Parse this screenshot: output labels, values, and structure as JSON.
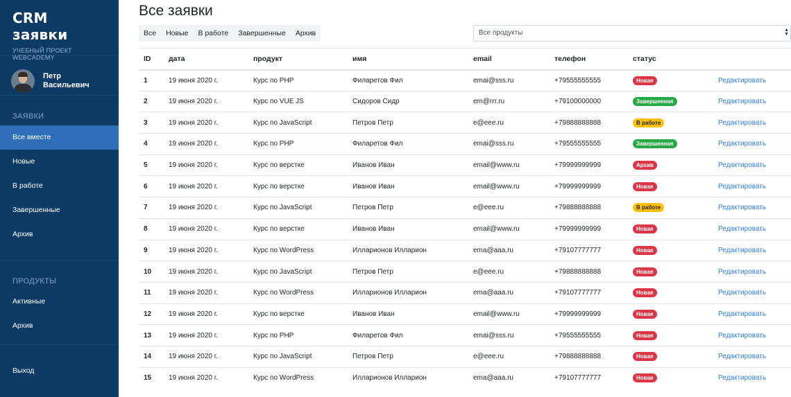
{
  "sidebar": {
    "brand_title": "CRM заявки",
    "brand_subtitle": "УЧЕБНЫЙ ПРОЕКТ WEBCADEMY",
    "user_first": "Петр",
    "user_last": "Васильевич",
    "section_requests": "ЗАЯВКИ",
    "requests_items": [
      "Все вместе",
      "Новые",
      "В работе",
      "Завершенные",
      "Архив"
    ],
    "section_products": "ПРОДУКТЫ",
    "products_items": [
      "Активные",
      "Архив"
    ],
    "logout": "Выход"
  },
  "main": {
    "title": "Все заявки",
    "filters": [
      "Все",
      "Новые",
      "В работе",
      "Завершенные",
      "Архив"
    ],
    "product_select": "Все продукты"
  },
  "table": {
    "headers": [
      "ID",
      "дата",
      "продукт",
      "имя",
      "email",
      "телефон",
      "статус",
      ""
    ],
    "edit_label": "Редактировать",
    "rows": [
      {
        "id": "1",
        "date": "19 июня 2020 г.",
        "product": "Курс по PHP",
        "name": "Филаретов Фил",
        "email": "emai@sss.ru",
        "phone": "+79555555555",
        "status": "Новая",
        "status_type": "new"
      },
      {
        "id": "2",
        "date": "19 июня 2020 г.",
        "product": "Курс по VUE JS",
        "name": "Сидоров Сидр",
        "email": "em@rrr.ru",
        "phone": "+79100000000",
        "status": "Завершенная",
        "status_type": "done"
      },
      {
        "id": "3",
        "date": "19 июня 2020 г.",
        "product": "Курс по JavaScript",
        "name": "Петров Петр",
        "email": "e@eee.ru",
        "phone": "+79888888888",
        "status": "В работе",
        "status_type": "work"
      },
      {
        "id": "4",
        "date": "19 июня 2020 г.",
        "product": "Курс по PHP",
        "name": "Филаретов Фил",
        "email": "emai@sss.ru",
        "phone": "+79555555555",
        "status": "Завершенная",
        "status_type": "done"
      },
      {
        "id": "5",
        "date": "19 июня 2020 г.",
        "product": "Курс по верстке",
        "name": "Иванов Иван",
        "email": "email@www.ru",
        "phone": "+79999999999",
        "status": "Архив",
        "status_type": "archive"
      },
      {
        "id": "6",
        "date": "19 июня 2020 г.",
        "product": "Курс по верстке",
        "name": "Иванов Иван",
        "email": "email@www.ru",
        "phone": "+79999999999",
        "status": "Новая",
        "status_type": "new"
      },
      {
        "id": "7",
        "date": "19 июня 2020 г.",
        "product": "Курс по JavaScript",
        "name": "Петров Петр",
        "email": "e@eee.ru",
        "phone": "+79888888888",
        "status": "В работе",
        "status_type": "work"
      },
      {
        "id": "8",
        "date": "19 июня 2020 г.",
        "product": "Курс по верстке",
        "name": "Иванов Иван",
        "email": "email@www.ru",
        "phone": "+79999999999",
        "status": "Новая",
        "status_type": "new"
      },
      {
        "id": "9",
        "date": "19 июня 2020 г.",
        "product": "Курс по WordPress",
        "name": "Илларионов Илларион",
        "email": "ema@aaa.ru",
        "phone": "+79107777777",
        "status": "Новая",
        "status_type": "new"
      },
      {
        "id": "10",
        "date": "19 июня 2020 г.",
        "product": "Курс по JavaScript",
        "name": "Петров Петр",
        "email": "e@eee.ru",
        "phone": "+79888888888",
        "status": "Новая",
        "status_type": "new"
      },
      {
        "id": "11",
        "date": "19 июня 2020 г.",
        "product": "Курс по WordPress",
        "name": "Илларионов Илларион",
        "email": "ema@aaa.ru",
        "phone": "+79107777777",
        "status": "Новая",
        "status_type": "new"
      },
      {
        "id": "12",
        "date": "19 июня 2020 г.",
        "product": "Курс по верстке",
        "name": "Иванов Иван",
        "email": "email@www.ru",
        "phone": "+79999999999",
        "status": "Новая",
        "status_type": "new"
      },
      {
        "id": "13",
        "date": "19 июня 2020 г.",
        "product": "Курс по PHP",
        "name": "Филаретов Фил",
        "email": "emai@sss.ru",
        "phone": "+79555555555",
        "status": "Новая",
        "status_type": "new"
      },
      {
        "id": "14",
        "date": "19 июня 2020 г.",
        "product": "Курс по JavaScript",
        "name": "Петров Петр",
        "email": "e@eee.ru",
        "phone": "+79888888888",
        "status": "Новая",
        "status_type": "new"
      },
      {
        "id": "15",
        "date": "19 июня 2020 г.",
        "product": "Курс по WordPress",
        "name": "Илларионов Илларион",
        "email": "ema@aaa.ru",
        "phone": "+79107777777",
        "status": "Новая",
        "status_type": "new"
      }
    ]
  },
  "colors": {
    "sidebar_bg": "#0e3b66",
    "sidebar_active": "#2e6fb7",
    "link": "#2f7dd5",
    "status_new": "#dc3545",
    "status_done": "#28a745",
    "status_work": "#ffc107"
  }
}
